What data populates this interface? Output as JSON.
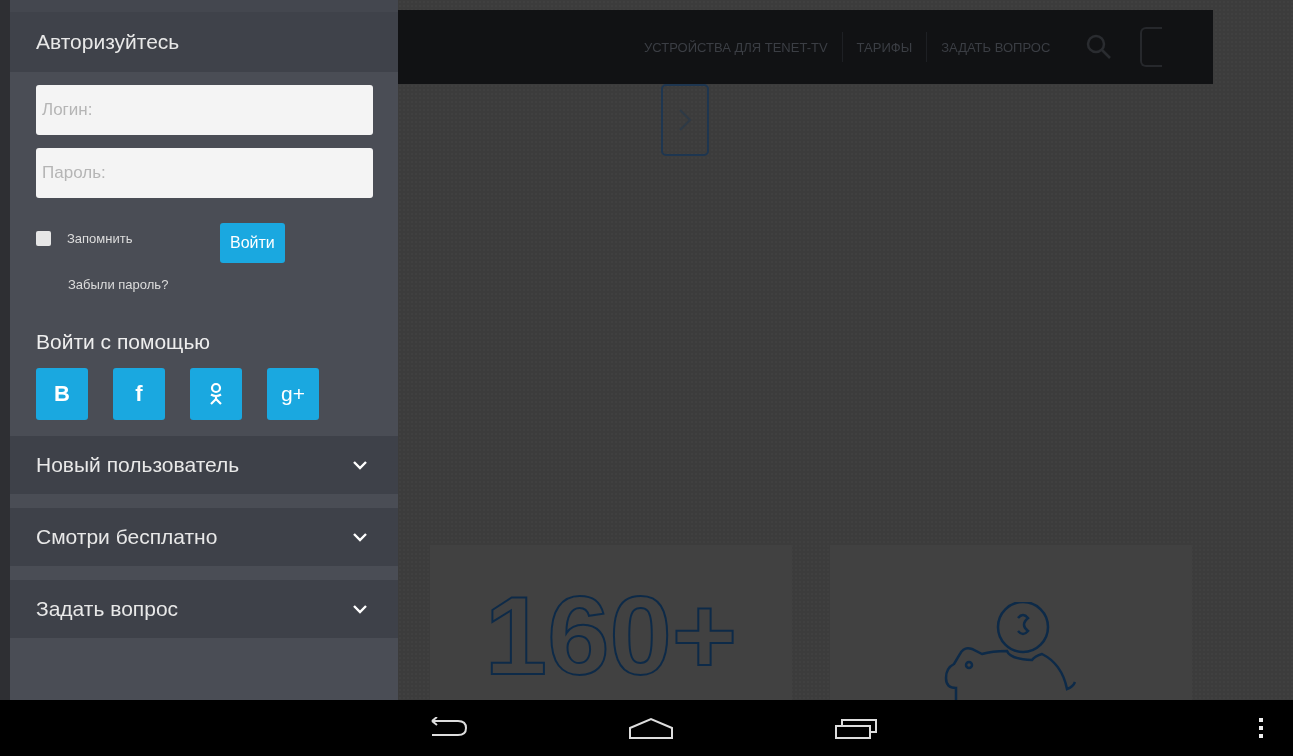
{
  "sidebar": {
    "title": "Авторизуйтесь",
    "login_field": {
      "placeholder": "Логин:"
    },
    "password_field": {
      "placeholder": "Пароль:"
    },
    "remember": {
      "label": "Запомнить",
      "checked": false
    },
    "login_button": "Войти",
    "forgot_link": "Забыли пароль?",
    "social_title": "Войти с помощью",
    "social_buttons": [
      {
        "kind": "vk",
        "label": "B"
      },
      {
        "kind": "facebook",
        "label": "f"
      },
      {
        "kind": "odnoklassniki"
      },
      {
        "kind": "googleplus",
        "label": "g+"
      }
    ],
    "accordion": [
      {
        "label": "Новый пользователь",
        "expanded": false
      },
      {
        "label": "Смотри бесплатно",
        "expanded": false
      },
      {
        "label": "Задать вопрос",
        "expanded": false
      }
    ]
  },
  "top_nav": {
    "links": [
      "УСТРОЙСТВА ДЛЯ TENET-TV",
      "ТАРИФЫ",
      "ЗАДАТЬ ВОПРОС"
    ]
  },
  "main": {
    "stat": "160+"
  }
}
